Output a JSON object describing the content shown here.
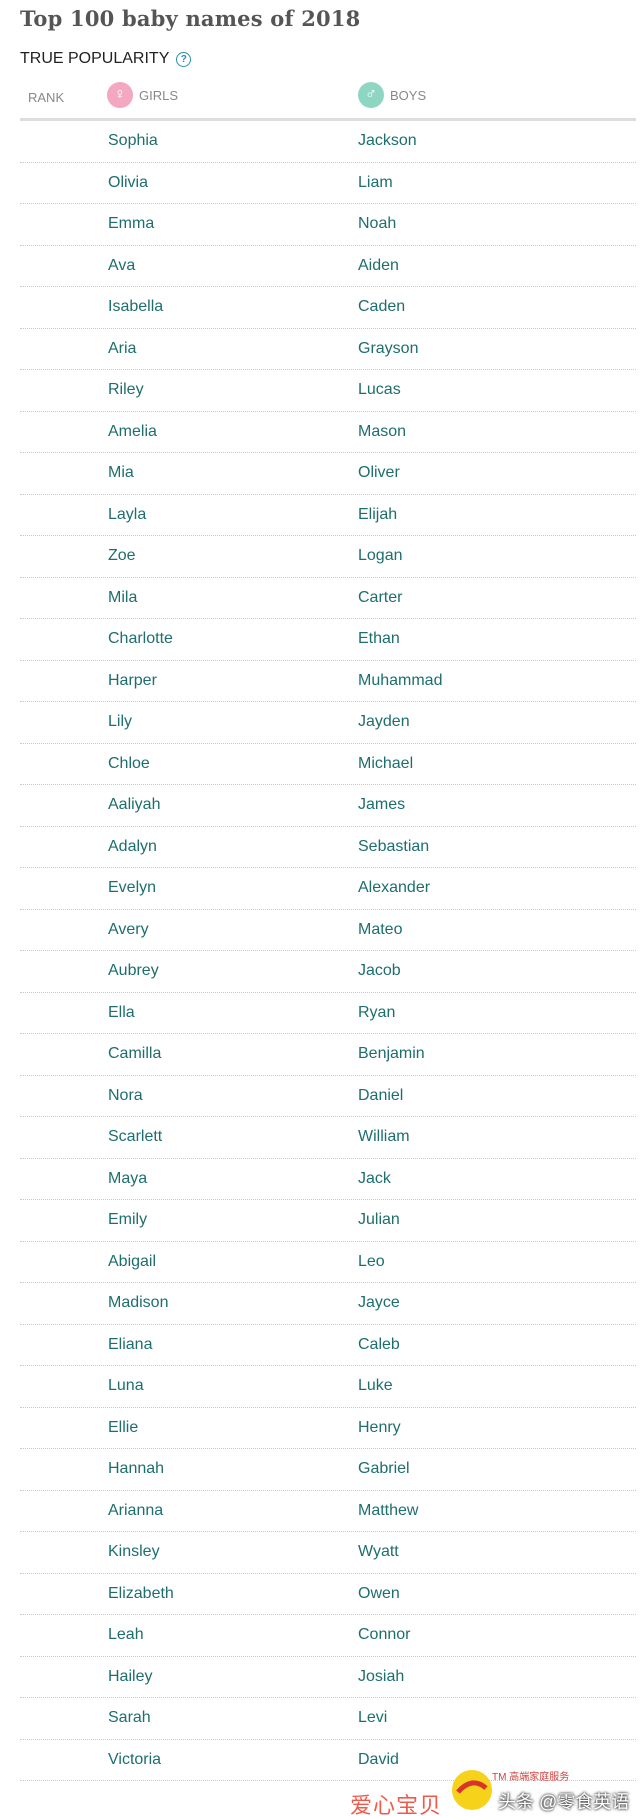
{
  "page": {
    "title": "Top 100 baby names of 2018",
    "subtitle": "TRUE POPULARITY",
    "help_icon": "?"
  },
  "columns": {
    "rank": "RANK",
    "girls": "GIRLS",
    "boys": "BOYS",
    "girls_icon": "♀",
    "boys_icon": "♂"
  },
  "rows": [
    {
      "girl": "Sophia",
      "boy": "Jackson"
    },
    {
      "girl": "Olivia",
      "boy": "Liam"
    },
    {
      "girl": "Emma",
      "boy": "Noah"
    },
    {
      "girl": "Ava",
      "boy": "Aiden"
    },
    {
      "girl": "Isabella",
      "boy": "Caden"
    },
    {
      "girl": "Aria",
      "boy": "Grayson"
    },
    {
      "girl": "Riley",
      "boy": "Lucas"
    },
    {
      "girl": "Amelia",
      "boy": "Mason"
    },
    {
      "girl": "Mia",
      "boy": "Oliver"
    },
    {
      "girl": "Layla",
      "boy": "Elijah"
    },
    {
      "girl": "Zoe",
      "boy": "Logan"
    },
    {
      "girl": "Mila",
      "boy": "Carter"
    },
    {
      "girl": "Charlotte",
      "boy": "Ethan"
    },
    {
      "girl": "Harper",
      "boy": "Muhammad"
    },
    {
      "girl": "Lily",
      "boy": "Jayden"
    },
    {
      "girl": "Chloe",
      "boy": "Michael"
    },
    {
      "girl": "Aaliyah",
      "boy": "James"
    },
    {
      "girl": "Adalyn",
      "boy": "Sebastian"
    },
    {
      "girl": "Evelyn",
      "boy": "Alexander"
    },
    {
      "girl": "Avery",
      "boy": "Mateo"
    },
    {
      "girl": "Aubrey",
      "boy": "Jacob"
    },
    {
      "girl": "Ella",
      "boy": "Ryan"
    },
    {
      "girl": "Camilla",
      "boy": "Benjamin"
    },
    {
      "girl": "Nora",
      "boy": "Daniel"
    },
    {
      "girl": "Scarlett",
      "boy": "William"
    },
    {
      "girl": "Maya",
      "boy": "Jack"
    },
    {
      "girl": "Emily",
      "boy": "Julian"
    },
    {
      "girl": "Abigail",
      "boy": "Leo"
    },
    {
      "girl": "Madison",
      "boy": "Jayce"
    },
    {
      "girl": "Eliana",
      "boy": "Caleb"
    },
    {
      "girl": "Luna",
      "boy": "Luke"
    },
    {
      "girl": "Ellie",
      "boy": "Henry"
    },
    {
      "girl": "Hannah",
      "boy": "Gabriel"
    },
    {
      "girl": "Arianna",
      "boy": "Matthew"
    },
    {
      "girl": "Kinsley",
      "boy": "Wyatt"
    },
    {
      "girl": "Elizabeth",
      "boy": "Owen"
    },
    {
      "girl": "Leah",
      "boy": "Connor"
    },
    {
      "girl": "Hailey",
      "boy": "Josiah"
    },
    {
      "girl": "Sarah",
      "boy": "Levi"
    },
    {
      "girl": "Victoria",
      "boy": "David"
    }
  ],
  "watermark": {
    "left_text": "爱心宝贝",
    "tm_text": "TM 高端家庭服务",
    "right_text": "头条 @零食英语"
  },
  "colors": {
    "name_text": "#1e6e6e",
    "girl_icon_bg": "#f4a7c0",
    "boy_icon_bg": "#8fd6c2",
    "help_icon": "#2a8fa0"
  },
  "icons": {
    "help": "question-circle-icon",
    "girls": "female-symbol-icon",
    "boys": "male-symbol-icon"
  }
}
